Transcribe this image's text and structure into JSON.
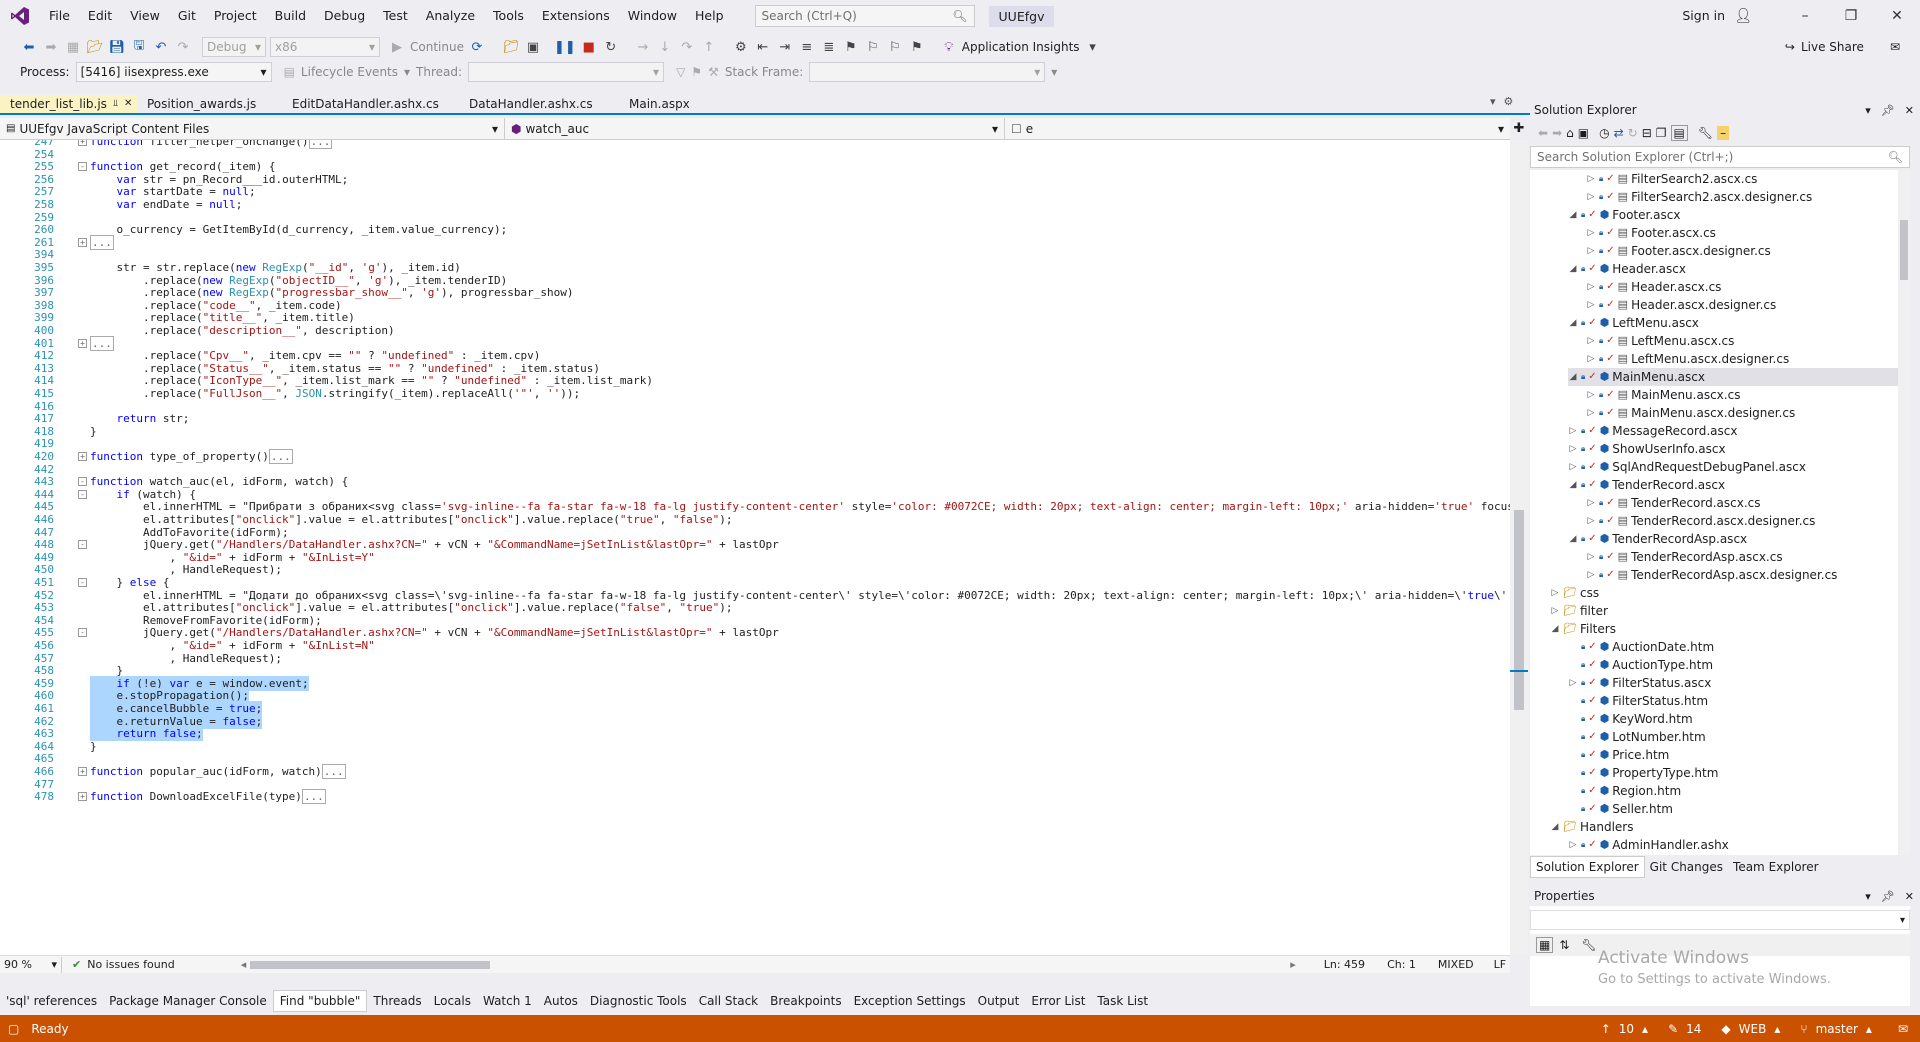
{
  "menubar": {
    "items": [
      "File",
      "Edit",
      "View",
      "Git",
      "Project",
      "Build",
      "Debug",
      "Test",
      "Analyze",
      "Tools",
      "Extensions",
      "Window",
      "Help"
    ],
    "search_placeholder": "Search (Ctrl+Q)",
    "solution_name": "UUEfgv",
    "sign_in": "Sign in"
  },
  "toolbar": {
    "config": "Debug",
    "platform": "x86",
    "continue": "Continue",
    "app_insights": "Application Insights",
    "live_share": "Live Share"
  },
  "toolbar2": {
    "process_label": "Process:",
    "process_value": "[5416] iisexpress.exe",
    "lifecycle": "Lifecycle Events",
    "thread_label": "Thread:",
    "stack_label": "Stack Frame:"
  },
  "tabs": [
    {
      "label": "tender_list_lib.js",
      "active": true
    },
    {
      "label": "Position_awards.js",
      "active": false
    },
    {
      "label": "EditDataHandler.ashx.cs",
      "active": false
    },
    {
      "label": "DataHandler.ashx.cs",
      "active": false
    },
    {
      "label": "Main.aspx",
      "active": false
    }
  ],
  "navbar": {
    "project": "UUEfgv JavaScript Content Files",
    "member": "watch_auc",
    "scope": "e"
  },
  "code_lines": [
    {
      "n": "247",
      "fold": "+",
      "t": "function filter_helper_onchange()[...]",
      "sel": false
    },
    {
      "n": "254",
      "fold": "",
      "t": "",
      "sel": false
    },
    {
      "n": "255",
      "fold": "-",
      "t": "function get_record(_item) {",
      "sel": false
    },
    {
      "n": "256",
      "fold": "",
      "t": "    var str = pn_Record___id.outerHTML;",
      "sel": false
    },
    {
      "n": "257",
      "fold": "",
      "t": "    var startDate = null;",
      "sel": false
    },
    {
      "n": "258",
      "fold": "",
      "t": "    var endDate = null;",
      "sel": false
    },
    {
      "n": "259",
      "fold": "",
      "t": "",
      "sel": false
    },
    {
      "n": "260",
      "fold": "",
      "t": "    o_currency = GetItemById(d_currency, _item.value_currency);",
      "sel": false
    },
    {
      "n": "261",
      "fold": "+",
      "t": "[...]",
      "sel": false
    },
    {
      "n": "394",
      "fold": "",
      "t": "",
      "sel": false
    },
    {
      "n": "395",
      "fold": "",
      "t": "    str = str.replace(new RegExp(\"__id\", 'g'), _item.id)",
      "sel": false
    },
    {
      "n": "396",
      "fold": "",
      "t": "        .replace(new RegExp(\"objectID__\", 'g'), _item.tenderID)",
      "sel": false
    },
    {
      "n": "397",
      "fold": "",
      "t": "        .replace(new RegExp(\"progressbar_show__\", 'g'), progressbar_show)",
      "sel": false
    },
    {
      "n": "398",
      "fold": "",
      "t": "        .replace(\"code__\", _item.code)",
      "sel": false
    },
    {
      "n": "399",
      "fold": "",
      "t": "        .replace(\"title__\", _item.title)",
      "sel": false
    },
    {
      "n": "400",
      "fold": "",
      "t": "        .replace(\"description__\", description)",
      "sel": false
    },
    {
      "n": "401",
      "fold": "+",
      "t": "[...]",
      "sel": false
    },
    {
      "n": "412",
      "fold": "",
      "t": "        .replace(\"Cpv__\", _item.cpv == \"\" ? \"undefined\" : _item.cpv)",
      "sel": false
    },
    {
      "n": "413",
      "fold": "",
      "t": "        .replace(\"Status__\", _item.status == \"\" ? \"undefined\" : _item.status)",
      "sel": false
    },
    {
      "n": "414",
      "fold": "",
      "t": "        .replace(\"IconType__\", _item.list_mark == \"\" ? \"undefined\" : _item.list_mark)",
      "sel": false
    },
    {
      "n": "415",
      "fold": "",
      "t": "        .replace(\"FullJson__\", JSON.stringify(_item).replaceAll('\"', ''));",
      "sel": false
    },
    {
      "n": "416",
      "fold": "",
      "t": "",
      "sel": false
    },
    {
      "n": "417",
      "fold": "",
      "t": "    return str;",
      "sel": false
    },
    {
      "n": "418",
      "fold": "",
      "t": "}",
      "sel": false
    },
    {
      "n": "419",
      "fold": "",
      "t": "",
      "sel": false
    },
    {
      "n": "420",
      "fold": "+",
      "t": "function type_of_property()[...]",
      "sel": false
    },
    {
      "n": "442",
      "fold": "",
      "t": "",
      "sel": false
    },
    {
      "n": "443",
      "fold": "-",
      "t": "function watch_auc(el, idForm, watch) {",
      "sel": false
    },
    {
      "n": "444",
      "fold": "-",
      "t": "    if (watch) {",
      "sel": false
    },
    {
      "n": "445",
      "fold": "",
      "t": "        el.innerHTML = \"Прибрати з обраних<svg class='svg-inline--fa fa-star fa-w-18 fa-lg justify-content-center' style='color: #0072CE; width: 20px; text-align: center; margin-left: 10px;' aria-hidden='true' focusable=",
      "sel": false
    },
    {
      "n": "446",
      "fold": "",
      "t": "        el.attributes[\"onclick\"].value = el.attributes[\"onclick\"].value.replace(\"true\", \"false\");",
      "sel": false
    },
    {
      "n": "447",
      "fold": "",
      "t": "        AddToFavorite(idForm);",
      "sel": false
    },
    {
      "n": "448",
      "fold": "-",
      "t": "        jQuery.get(\"/Handlers/DataHandler.ashx?CN=\" + vCN + \"&CommandName=jSetInList&lastOpr=\" + lastOpr",
      "sel": false
    },
    {
      "n": "449",
      "fold": "",
      "t": "            , \"&id=\" + idForm + \"&InList=Y\"",
      "sel": false
    },
    {
      "n": "450",
      "fold": "",
      "t": "            , HandleRequest);",
      "sel": false
    },
    {
      "n": "451",
      "fold": "-",
      "t": "    } else {",
      "sel": false
    },
    {
      "n": "452",
      "fold": "",
      "t": "        el.innerHTML = \"Додати до обраних<svg class=\\'svg-inline--fa fa-star fa-w-18 fa-lg justify-content-center\\' style=\\'color: #0072CE; width: 20px; text-align: center; margin-left: 10px;\\' aria-hidden=\\'true\\' focus",
      "sel": false
    },
    {
      "n": "453",
      "fold": "",
      "t": "        el.attributes[\"onclick\"].value = el.attributes[\"onclick\"].value.replace(\"false\", \"true\");",
      "sel": false
    },
    {
      "n": "454",
      "fold": "",
      "t": "        RemoveFromFavorite(idForm);",
      "sel": false
    },
    {
      "n": "455",
      "fold": "-",
      "t": "        jQuery.get(\"/Handlers/DataHandler.ashx?CN=\" + vCN + \"&CommandName=jSetInList&lastOpr=\" + lastOpr",
      "sel": false
    },
    {
      "n": "456",
      "fold": "",
      "t": "            , \"&id=\" + idForm + \"&InList=N\"",
      "sel": false
    },
    {
      "n": "457",
      "fold": "",
      "t": "            , HandleRequest);",
      "sel": false
    },
    {
      "n": "458",
      "fold": "",
      "t": "    }",
      "sel": false
    },
    {
      "n": "459",
      "fold": "",
      "t": "    if (!e) var e = window.event;",
      "sel": true
    },
    {
      "n": "460",
      "fold": "",
      "t": "    e.stopPropagation();",
      "sel": true
    },
    {
      "n": "461",
      "fold": "",
      "t": "    e.cancelBubble = true;",
      "sel": true
    },
    {
      "n": "462",
      "fold": "",
      "t": "    e.returnValue = false;",
      "sel": true
    },
    {
      "n": "463",
      "fold": "",
      "t": "    return false;",
      "sel": true
    },
    {
      "n": "464",
      "fold": "",
      "t": "}",
      "sel": false
    },
    {
      "n": "465",
      "fold": "",
      "t": "",
      "sel": false
    },
    {
      "n": "466",
      "fold": "+",
      "t": "function popular_auc(idForm, watch)[...]",
      "sel": false
    },
    {
      "n": "477",
      "fold": "",
      "t": "",
      "sel": false
    },
    {
      "n": "478",
      "fold": "+",
      "t": "function DownloadExcelFile(type)[...]",
      "sel": false
    }
  ],
  "editor_status": {
    "zoom": "90 %",
    "issues": "No issues found",
    "ln": "Ln: 459",
    "ch": "Ch: 1",
    "eol_mode": "MIXED",
    "eol": "LF"
  },
  "bottom_tabs": [
    {
      "label": "'sql' references",
      "active": false
    },
    {
      "label": "Package Manager Console",
      "active": false
    },
    {
      "label": "Find \"bubble\"",
      "active": true
    },
    {
      "label": "Threads",
      "active": false
    },
    {
      "label": "Locals",
      "active": false
    },
    {
      "label": "Watch 1",
      "active": false
    },
    {
      "label": "Autos",
      "active": false
    },
    {
      "label": "Diagnostic Tools",
      "active": false
    },
    {
      "label": "Call Stack",
      "active": false
    },
    {
      "label": "Breakpoints",
      "active": false
    },
    {
      "label": "Exception Settings",
      "active": false
    },
    {
      "label": "Output",
      "active": false
    },
    {
      "label": "Error List",
      "active": false
    },
    {
      "label": "Task List",
      "active": false
    }
  ],
  "statusbar": {
    "ready": "Ready",
    "up_count": "10",
    "pencil_count": "14",
    "repo": "WEB",
    "branch": "master"
  },
  "solution_explorer": {
    "title": "Solution Explorer",
    "search_placeholder": "Search Solution Explorer (Ctrl+;)",
    "tree": [
      {
        "label": "FilterSearch2.ascx.cs",
        "level": 3,
        "exp": "right"
      },
      {
        "label": "FilterSearch2.ascx.designer.cs",
        "level": 3,
        "exp": "right"
      },
      {
        "label": "Footer.ascx",
        "level": 2,
        "exp": "down"
      },
      {
        "label": "Footer.ascx.cs",
        "level": 3,
        "exp": "right"
      },
      {
        "label": "Footer.ascx.designer.cs",
        "level": 3,
        "exp": "right"
      },
      {
        "label": "Header.ascx",
        "level": 2,
        "exp": "down"
      },
      {
        "label": "Header.ascx.cs",
        "level": 3,
        "exp": "right"
      },
      {
        "label": "Header.ascx.designer.cs",
        "level": 3,
        "exp": "right"
      },
      {
        "label": "LeftMenu.ascx",
        "level": 2,
        "exp": "down"
      },
      {
        "label": "LeftMenu.ascx.cs",
        "level": 3,
        "exp": "right"
      },
      {
        "label": "LeftMenu.ascx.designer.cs",
        "level": 3,
        "exp": "right"
      },
      {
        "label": "MainMenu.ascx",
        "level": 2,
        "exp": "down"
      },
      {
        "label": "MainMenu.ascx.cs",
        "level": 3,
        "exp": "right"
      },
      {
        "label": "MainMenu.ascx.designer.cs",
        "level": 3,
        "exp": "right"
      },
      {
        "label": "MessageRecord.ascx",
        "level": 2,
        "exp": "right"
      },
      {
        "label": "ShowUserInfo.ascx",
        "level": 2,
        "exp": "right"
      },
      {
        "label": "SqlAndRequestDebugPanel.ascx",
        "level": 2,
        "exp": "right"
      },
      {
        "label": "TenderRecord.ascx",
        "level": 2,
        "exp": "down"
      },
      {
        "label": "TenderRecord.ascx.cs",
        "level": 3,
        "exp": "right"
      },
      {
        "label": "TenderRecord.ascx.designer.cs",
        "level": 3,
        "exp": "right"
      },
      {
        "label": "TenderRecordAsp.ascx",
        "level": 2,
        "exp": "down"
      },
      {
        "label": "TenderRecordAsp.ascx.cs",
        "level": 3,
        "exp": "right"
      },
      {
        "label": "TenderRecordAsp.ascx.designer.cs",
        "level": 3,
        "exp": "right"
      },
      {
        "label": "css",
        "level": 1,
        "exp": "right"
      },
      {
        "label": "filter",
        "level": 1,
        "exp": "right"
      },
      {
        "label": "Filters",
        "level": 1,
        "exp": "down"
      },
      {
        "label": "AuctionDate.htm",
        "level": 2,
        "exp": ""
      },
      {
        "label": "AuctionType.htm",
        "level": 2,
        "exp": ""
      },
      {
        "label": "FilterStatus.ascx",
        "level": 2,
        "exp": "right"
      },
      {
        "label": "FilterStatus.htm",
        "level": 2,
        "exp": ""
      },
      {
        "label": "KeyWord.htm",
        "level": 2,
        "exp": ""
      },
      {
        "label": "LotNumber.htm",
        "level": 2,
        "exp": ""
      },
      {
        "label": "Price.htm",
        "level": 2,
        "exp": ""
      },
      {
        "label": "PropertyType.htm",
        "level": 2,
        "exp": ""
      },
      {
        "label": "Region.htm",
        "level": 2,
        "exp": ""
      },
      {
        "label": "Seller.htm",
        "level": 2,
        "exp": ""
      },
      {
        "label": "Handlers",
        "level": 1,
        "exp": "down"
      },
      {
        "label": "AdminHandler.ashx",
        "level": 2,
        "exp": "right"
      }
    ],
    "tabs": [
      {
        "label": "Solution Explorer",
        "active": true
      },
      {
        "label": "Git Changes",
        "active": false
      },
      {
        "label": "Team Explorer",
        "active": false
      }
    ]
  },
  "properties": {
    "title": "Properties",
    "watermark_title": "Activate Windows",
    "watermark_sub": "Go to Settings to activate Windows."
  }
}
